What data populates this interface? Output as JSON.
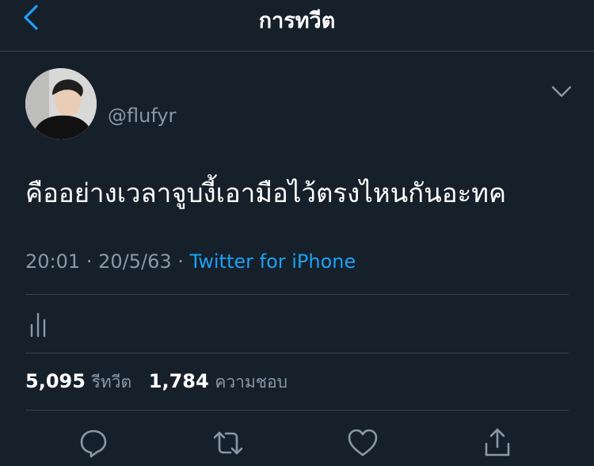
{
  "header": {
    "title": "การทวีต",
    "back_icon": "chevron-left-icon"
  },
  "tweet": {
    "handle": "@flufyr",
    "text": "คืออย่างเวลาจูบงี้เอามือไว้ตรงไหนกันอะทค",
    "time": "20:01",
    "date": "20/5/63",
    "separator": "·",
    "source": "Twitter for iPhone"
  },
  "stats": {
    "retweets_count": "5,095",
    "retweets_label": "รีทวีต",
    "likes_count": "1,784",
    "likes_label": "ความชอบ"
  },
  "actions": [
    "reply-icon",
    "retweet-icon",
    "like-icon",
    "share-icon"
  ],
  "colors": {
    "background": "#15202b",
    "divider": "#38444d",
    "secondary_text": "#8899a6",
    "accent": "#1da1f2"
  }
}
